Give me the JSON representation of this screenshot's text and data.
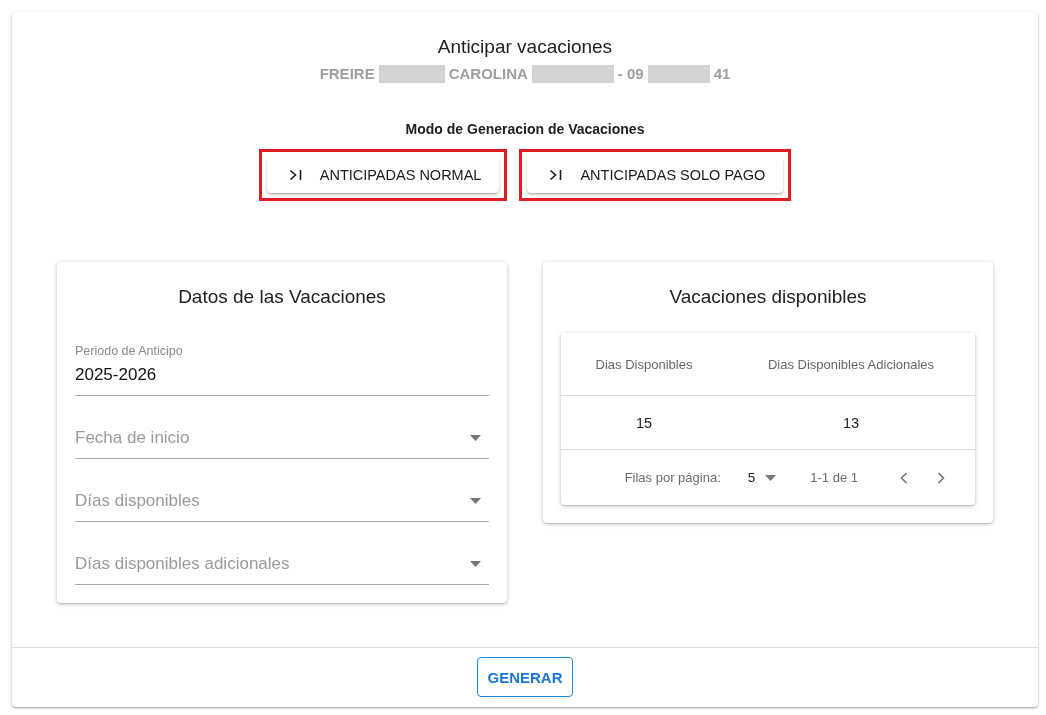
{
  "dialog": {
    "title": "Anticipar vacaciones",
    "subtitle": [
      {
        "kind": "text",
        "text": "FREIRE"
      },
      {
        "kind": "redacted"
      },
      {
        "kind": "text",
        "text": "CAROLINA"
      },
      {
        "kind": "redacted"
      },
      {
        "kind": "text",
        "text": "- 09"
      },
      {
        "kind": "redacted"
      },
      {
        "kind": "text",
        "text": "41"
      }
    ]
  },
  "mode": {
    "label": "Modo de Generacion de Vacaciones",
    "buttons": [
      {
        "label": "ANTICIPADAS NORMAL",
        "highlighted": true
      },
      {
        "label": "ANTICIPADAS SOLO PAGO",
        "highlighted": true
      }
    ]
  },
  "vacation_data": {
    "title": "Datos de las Vacaciones",
    "fields": [
      {
        "kind": "text",
        "label": "Periodo de Anticipo",
        "value": "2025-2026"
      },
      {
        "kind": "select",
        "placeholder": "Fecha de inicio"
      },
      {
        "kind": "select",
        "placeholder": "Días disponibles"
      },
      {
        "kind": "select",
        "placeholder": "Días disponibles adicionales"
      }
    ]
  },
  "available": {
    "title": "Vacaciones disponibles",
    "table": {
      "columns": [
        "Dias Disponibles",
        "Dias Disponibles Adicionales"
      ],
      "rows": [
        [
          "15",
          "13"
        ]
      ],
      "pagination": {
        "rows_per_page_label": "Filas por página:",
        "rows_per_page": "5",
        "range": "1-1 de 1"
      }
    }
  },
  "footer": {
    "button": "GENERAR"
  }
}
